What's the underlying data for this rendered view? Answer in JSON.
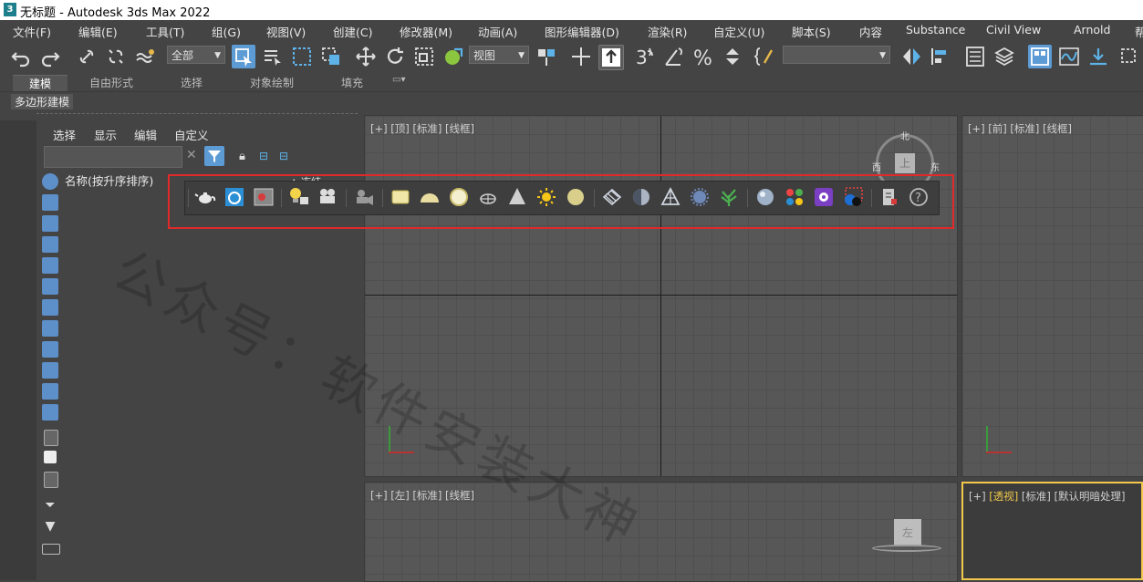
{
  "window": {
    "title": "无标题 - Autodesk 3ds Max 2022",
    "app_logo": "3"
  },
  "menu": [
    "文件(F)",
    "编辑(E)",
    "工具(T)",
    "组(G)",
    "视图(V)",
    "创建(C)",
    "修改器(M)",
    "动画(A)",
    "图形编辑器(D)",
    "渲染(R)",
    "自定义(U)",
    "脚本(S)",
    "内容",
    "Substance",
    "Civil View",
    "Arnold",
    "帮"
  ],
  "toolbar": {
    "selection_filter": "全部",
    "ref_coord": "视图",
    "named_selection": ""
  },
  "ribbon": {
    "tabs": [
      "建模",
      "自由形式",
      "选择",
      "对象绘制",
      "填充"
    ],
    "active": "建模",
    "sub": "多边形建模"
  },
  "explorer": {
    "menu": [
      "选择",
      "显示",
      "编辑",
      "自定义"
    ],
    "column_header": "名称(按升序排序)",
    "search_placeholder": ""
  },
  "floating_toolbar": {
    "partial_label": "▲ 冻结"
  },
  "viewports": {
    "top": {
      "label": "[+] [顶] [标准] [线框]"
    },
    "front": {
      "label": "[+] [前] [标准] [线框]"
    },
    "left": {
      "label": "[+] [左] [标准] [线框]"
    },
    "persp": {
      "plus": "[+]",
      "name": "[透视]",
      "rest": "[标准] [默认明暗处理]"
    }
  },
  "viewcube": {
    "top_face": "上",
    "left_face": "左",
    "north": "北",
    "west": "西",
    "east": "东"
  },
  "watermark": "公众号：软件安装大神",
  "colors": {
    "background": "#444444",
    "viewport": "#575757",
    "grid": "#4f4f4f",
    "highlight": "#5d9bd5",
    "red_box": "#e02a2a",
    "active_label": "#f2c94c"
  }
}
